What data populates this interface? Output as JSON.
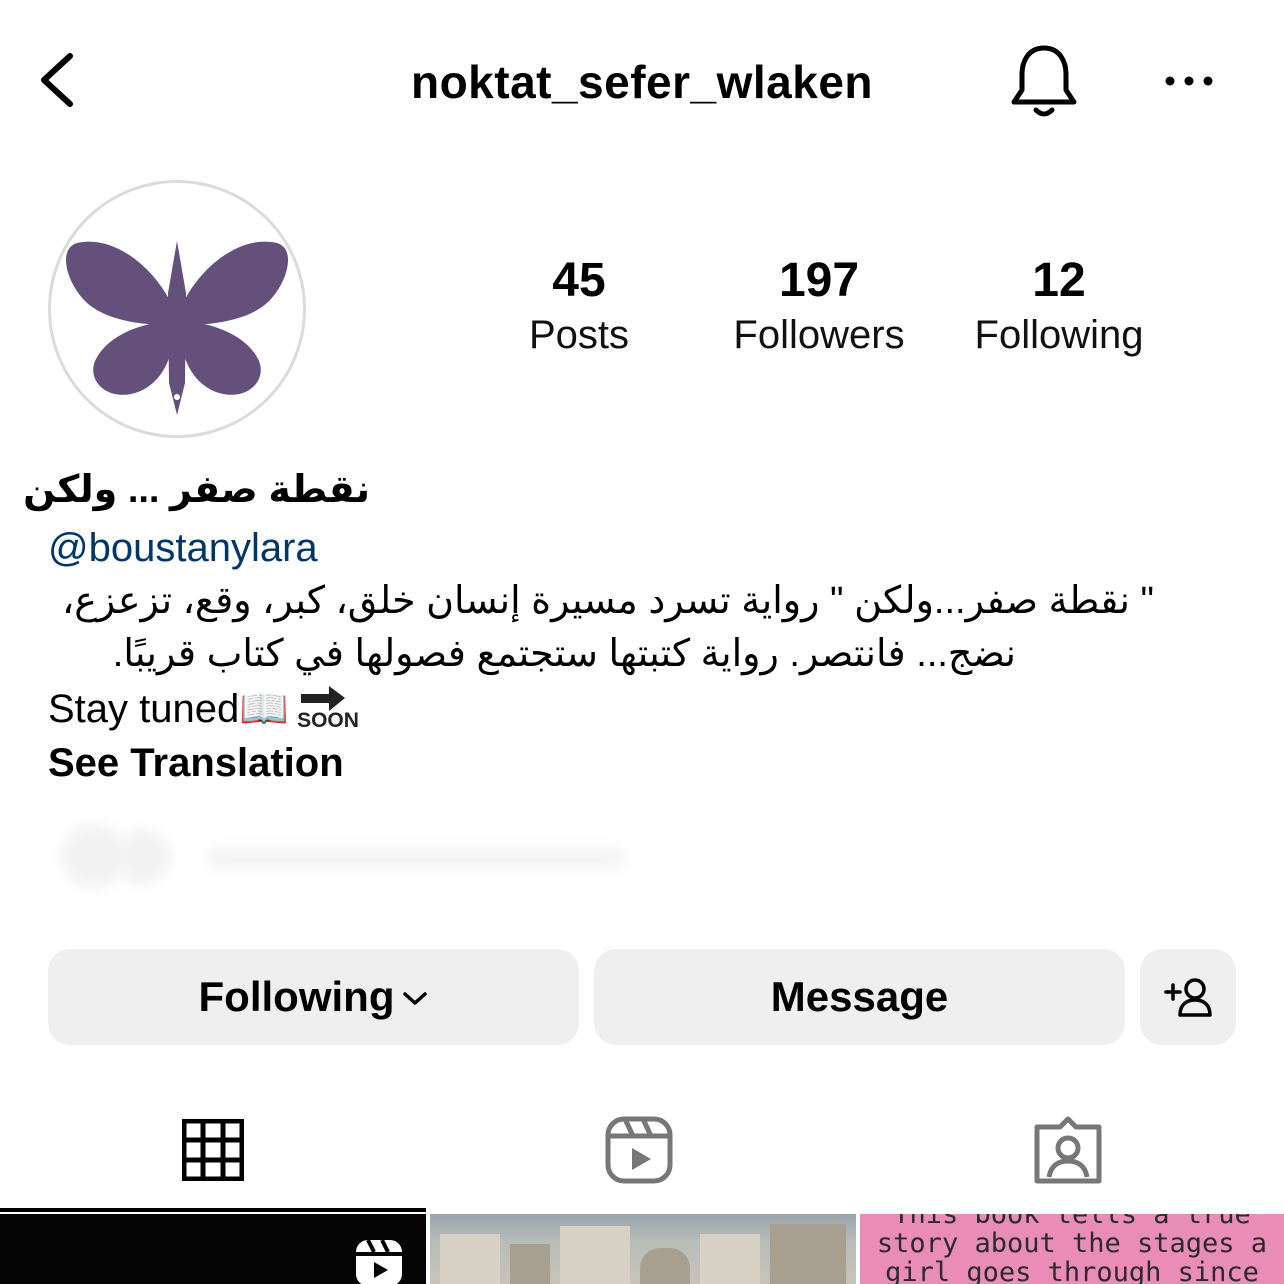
{
  "header": {
    "title": "noktat_sefer_wlaken",
    "back_icon": "chevron-left-icon",
    "notification_icon": "bell-icon",
    "more_icon": "more-horizontal-icon"
  },
  "profile": {
    "avatar_icon": "butterfly-pen-icon",
    "avatar_color": "#65507b",
    "stats": [
      {
        "value": "45",
        "label": "Posts"
      },
      {
        "value": "197",
        "label": "Followers"
      },
      {
        "value": "12",
        "label": "Following"
      }
    ]
  },
  "bio": {
    "display_name": "نقطة صفر ... ولكن",
    "handle": "@boustanylara",
    "line1": "\" نقطة صفر...ولكن \" رواية تسرد مسيرة إنسان خلق، كبر، وقع، تزعزع،",
    "line2": "نضج... فانتصر. رواية كتبتها  ستجتمع فصولها في كتاب قريبًا.",
    "line3": "Stay tuned📖",
    "soon_label": "SOON",
    "soon_icon": "soon-arrow-icon",
    "see_translation": "See Translation"
  },
  "actions": {
    "following_label": "Following",
    "following_icon": "chevron-down-icon",
    "message_label": "Message",
    "add_person_icon": "add-person-icon"
  },
  "tabs": [
    {
      "icon": "grid-icon",
      "active": true
    },
    {
      "icon": "reels-icon",
      "active": false
    },
    {
      "icon": "tagged-icon",
      "active": false
    }
  ],
  "thumbnails": [
    {
      "type": "reel",
      "icon": "reels-icon"
    },
    {
      "type": "photo"
    },
    {
      "type": "text-post",
      "text": "This book tells a true story about the stages a girl goes through since her childhood"
    }
  ]
}
